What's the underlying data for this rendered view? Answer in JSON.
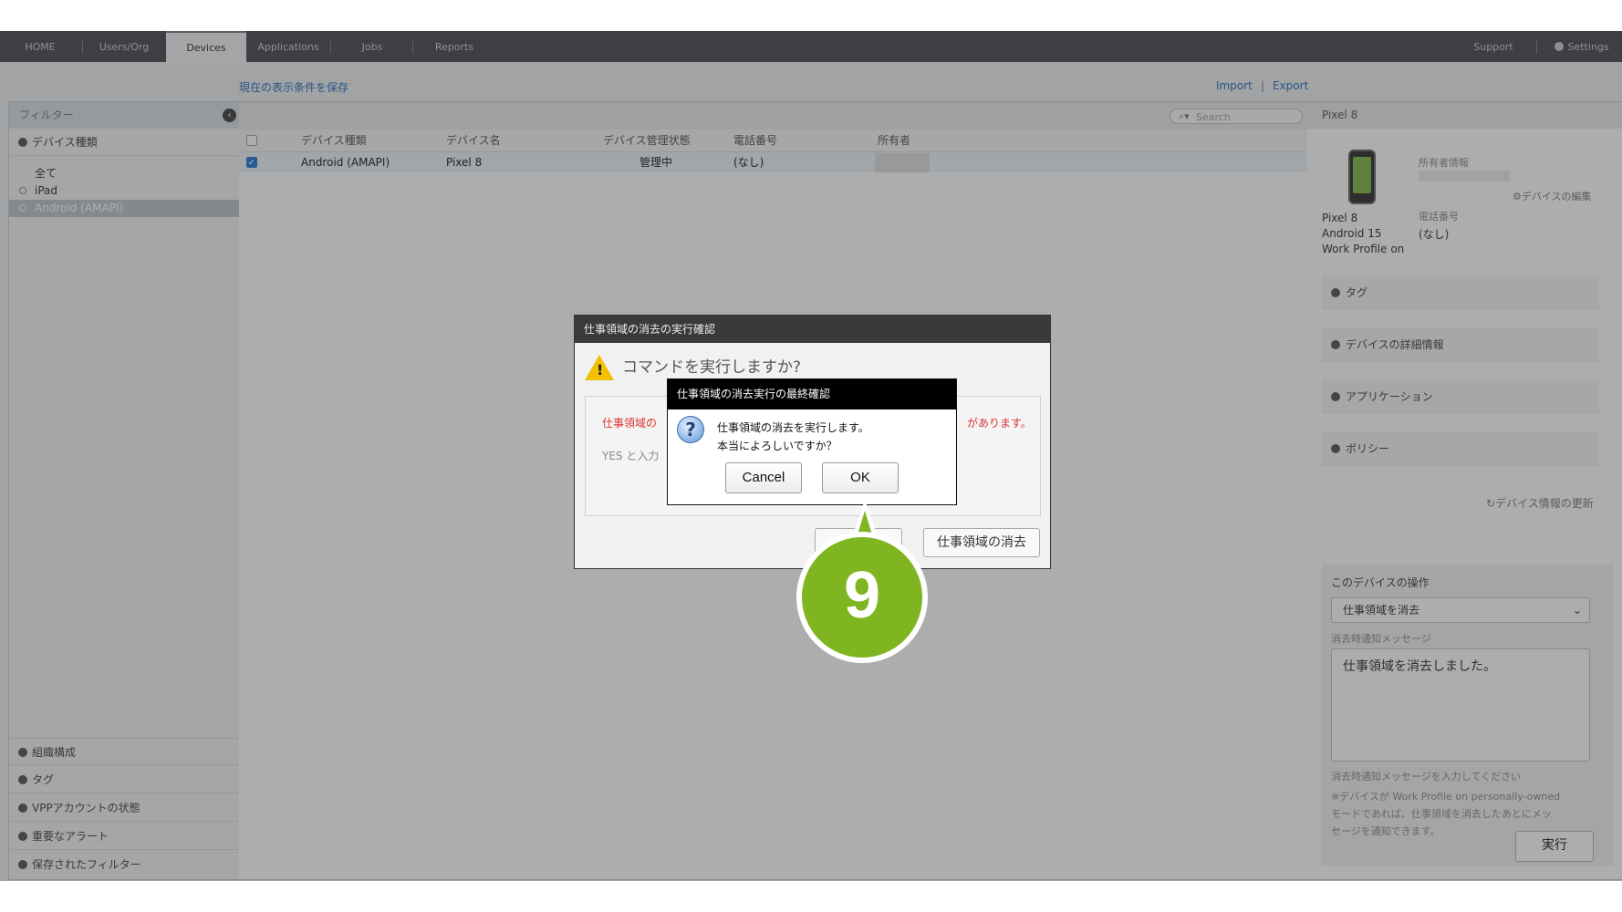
{
  "nav": {
    "items": [
      "HOME",
      "Users/Org",
      "Devices",
      "Applications",
      "Jobs",
      "Reports"
    ],
    "active": "Devices",
    "support": "Support",
    "settings": "Settings"
  },
  "toolbar": {
    "save_view": "現在の表示条件を保存",
    "import": "Import",
    "separator": "|",
    "export": "Export"
  },
  "filter": {
    "header": "フィルター",
    "device_type": "デバイス種類",
    "items": [
      "全て",
      "iPad",
      "Android (AMAPI)"
    ],
    "selected": "Android (AMAPI)",
    "bottom_sections": [
      "組織構成",
      "タグ",
      "VPPアカウントの状態",
      "重要なアラート",
      "保存されたフィルター"
    ]
  },
  "list": {
    "search_placeholder": "Search",
    "columns": [
      "デバイス種類",
      "デバイス名",
      "デバイス管理状態",
      "電話番号",
      "所有者"
    ],
    "rows": [
      {
        "checked": true,
        "type": "Android (AMAPI)",
        "name": "Pixel 8",
        "status": "管理中",
        "phone": "(なし)",
        "owner": ""
      }
    ]
  },
  "detail": {
    "title": "Pixel 8",
    "owner_label": "所有者情報",
    "edit_link": "デバイスの編集",
    "model": "Pixel 8",
    "os": "Android 15",
    "profile": "Work Profile on",
    "phone_label": "電話番号",
    "phone_value": "(なし)",
    "sections": [
      "タグ",
      "デバイスの詳細情報",
      "アプリケーション",
      "ポリシー"
    ],
    "refresh": "デバイス情報の更新",
    "ops_title": "このデバイスの操作",
    "ops_selected": "仕事領域を消去",
    "notify_label": "消去時通知メッセージ",
    "notify_value": "仕事領域を消去しました。",
    "notify_hint": "消去時通知メッセージを入力してください",
    "note_lines": [
      "※デバイスが Work Profile on personally-owned",
      "モードであれば、仕事領域を消去したあとにメッ",
      "セージを通知できます。"
    ],
    "execute": "実行"
  },
  "dialog1": {
    "title": "仕事領域の消去の実行確認",
    "question": "コマンドを実行しますか?",
    "red_left": "仕事領域の",
    "red_right": "があります。",
    "grey_left": "YES と入力",
    "confirm_button": "仕事領域の消去"
  },
  "dialog2": {
    "title": "仕事領域の消去実行の最終確認",
    "line1": "仕事領域の消去を実行します。",
    "line2": "本当によろしいですか？",
    "cancel": "Cancel",
    "ok": "OK"
  },
  "step": {
    "number": "9",
    "color": "#7fb520"
  }
}
